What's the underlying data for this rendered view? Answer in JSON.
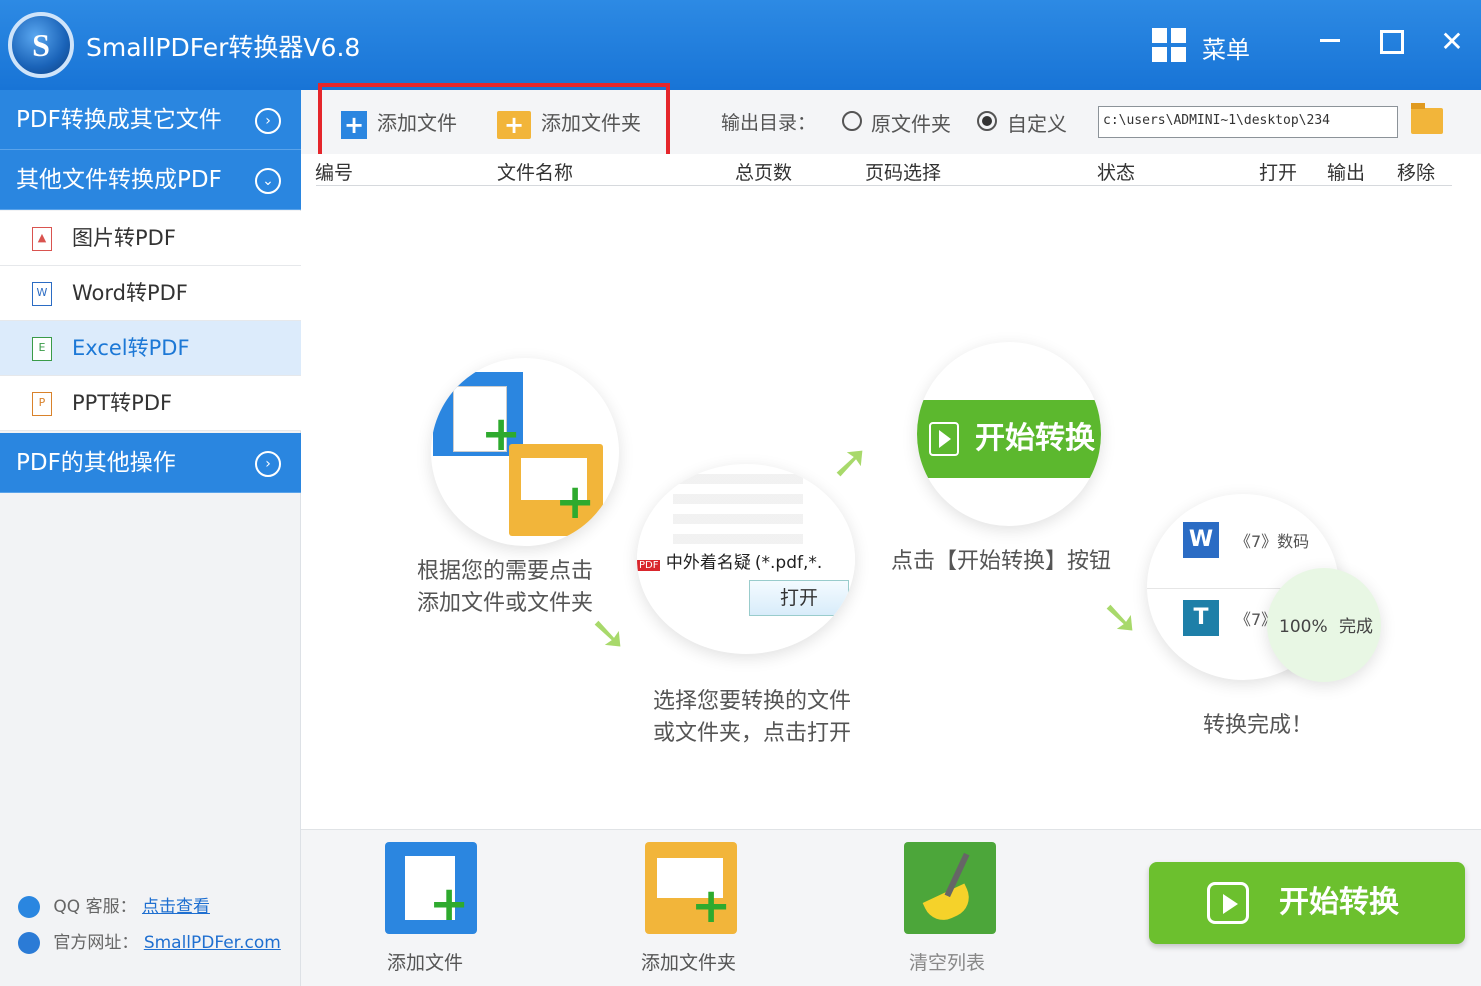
{
  "app": {
    "title": "SmallPDFer转换器V6.8",
    "logo_letter": "S",
    "menu_label": "菜单"
  },
  "sidebar": {
    "sections": [
      {
        "label": "PDF转换成其它文件",
        "icon": "chevron-right-circle-icon"
      },
      {
        "label": "其他文件转换成PDF",
        "icon": "chevron-down-circle-icon"
      },
      {
        "label": "PDF的其他操作",
        "icon": "chevron-right-circle-icon"
      }
    ],
    "items": [
      {
        "label": "图片转PDF",
        "icon": "image-file-icon"
      },
      {
        "label": "Word转PDF",
        "icon": "word-file-icon",
        "glyph": "W"
      },
      {
        "label": "Excel转PDF",
        "icon": "excel-file-icon",
        "glyph": "E",
        "active": true
      },
      {
        "label": "PPT转PDF",
        "icon": "ppt-file-icon",
        "glyph": "P"
      }
    ],
    "footer": {
      "qq_label": "QQ 客服：",
      "qq_link": "点击查看",
      "site_label": "官方网址：",
      "site_link": "SmallPDFer.com"
    }
  },
  "toolbar": {
    "add_file": "添加文件",
    "add_folder": "添加文件夹",
    "output_label": "输出目录：",
    "radio_original": "原文件夹",
    "radio_custom": "自定义",
    "selected": "自定义",
    "output_path": "c:\\users\\ADMINI~1\\desktop\\234"
  },
  "table": {
    "columns": [
      "编号",
      "文件名称",
      "总页数",
      "页码选择",
      "状态",
      "打开",
      "输出",
      "移除"
    ]
  },
  "guide": {
    "step1": [
      "根据您的需要点击",
      "添加文件或文件夹"
    ],
    "step2": [
      "选择您要转换的文件",
      "或文件夹，点击打开"
    ],
    "step3": "点击【开始转换】按钮",
    "step4": "转换完成！",
    "demo_start": "开始转换",
    "demo_file": "中外着名疑",
    "demo_filter": "(*.pdf,*.",
    "demo_open": "打开",
    "demo_list1": "《7》数码",
    "demo_list2": "《7》",
    "demo_progress": "100%",
    "demo_done": "完成",
    "demo_pdf_badge": "PDF",
    "demo_word_badge": "W",
    "demo_t_badge": "T"
  },
  "bottom": {
    "add_file": "添加文件",
    "add_folder": "添加文件夹",
    "clear_list": "清空列表",
    "start": "开始转换"
  },
  "colors": {
    "title_bar": "#1874d6",
    "sidebar_head": "#2a86e0",
    "active_item": "#dcebfb",
    "start_green": "#6cc02e",
    "highlight_red": "#e5262b"
  }
}
